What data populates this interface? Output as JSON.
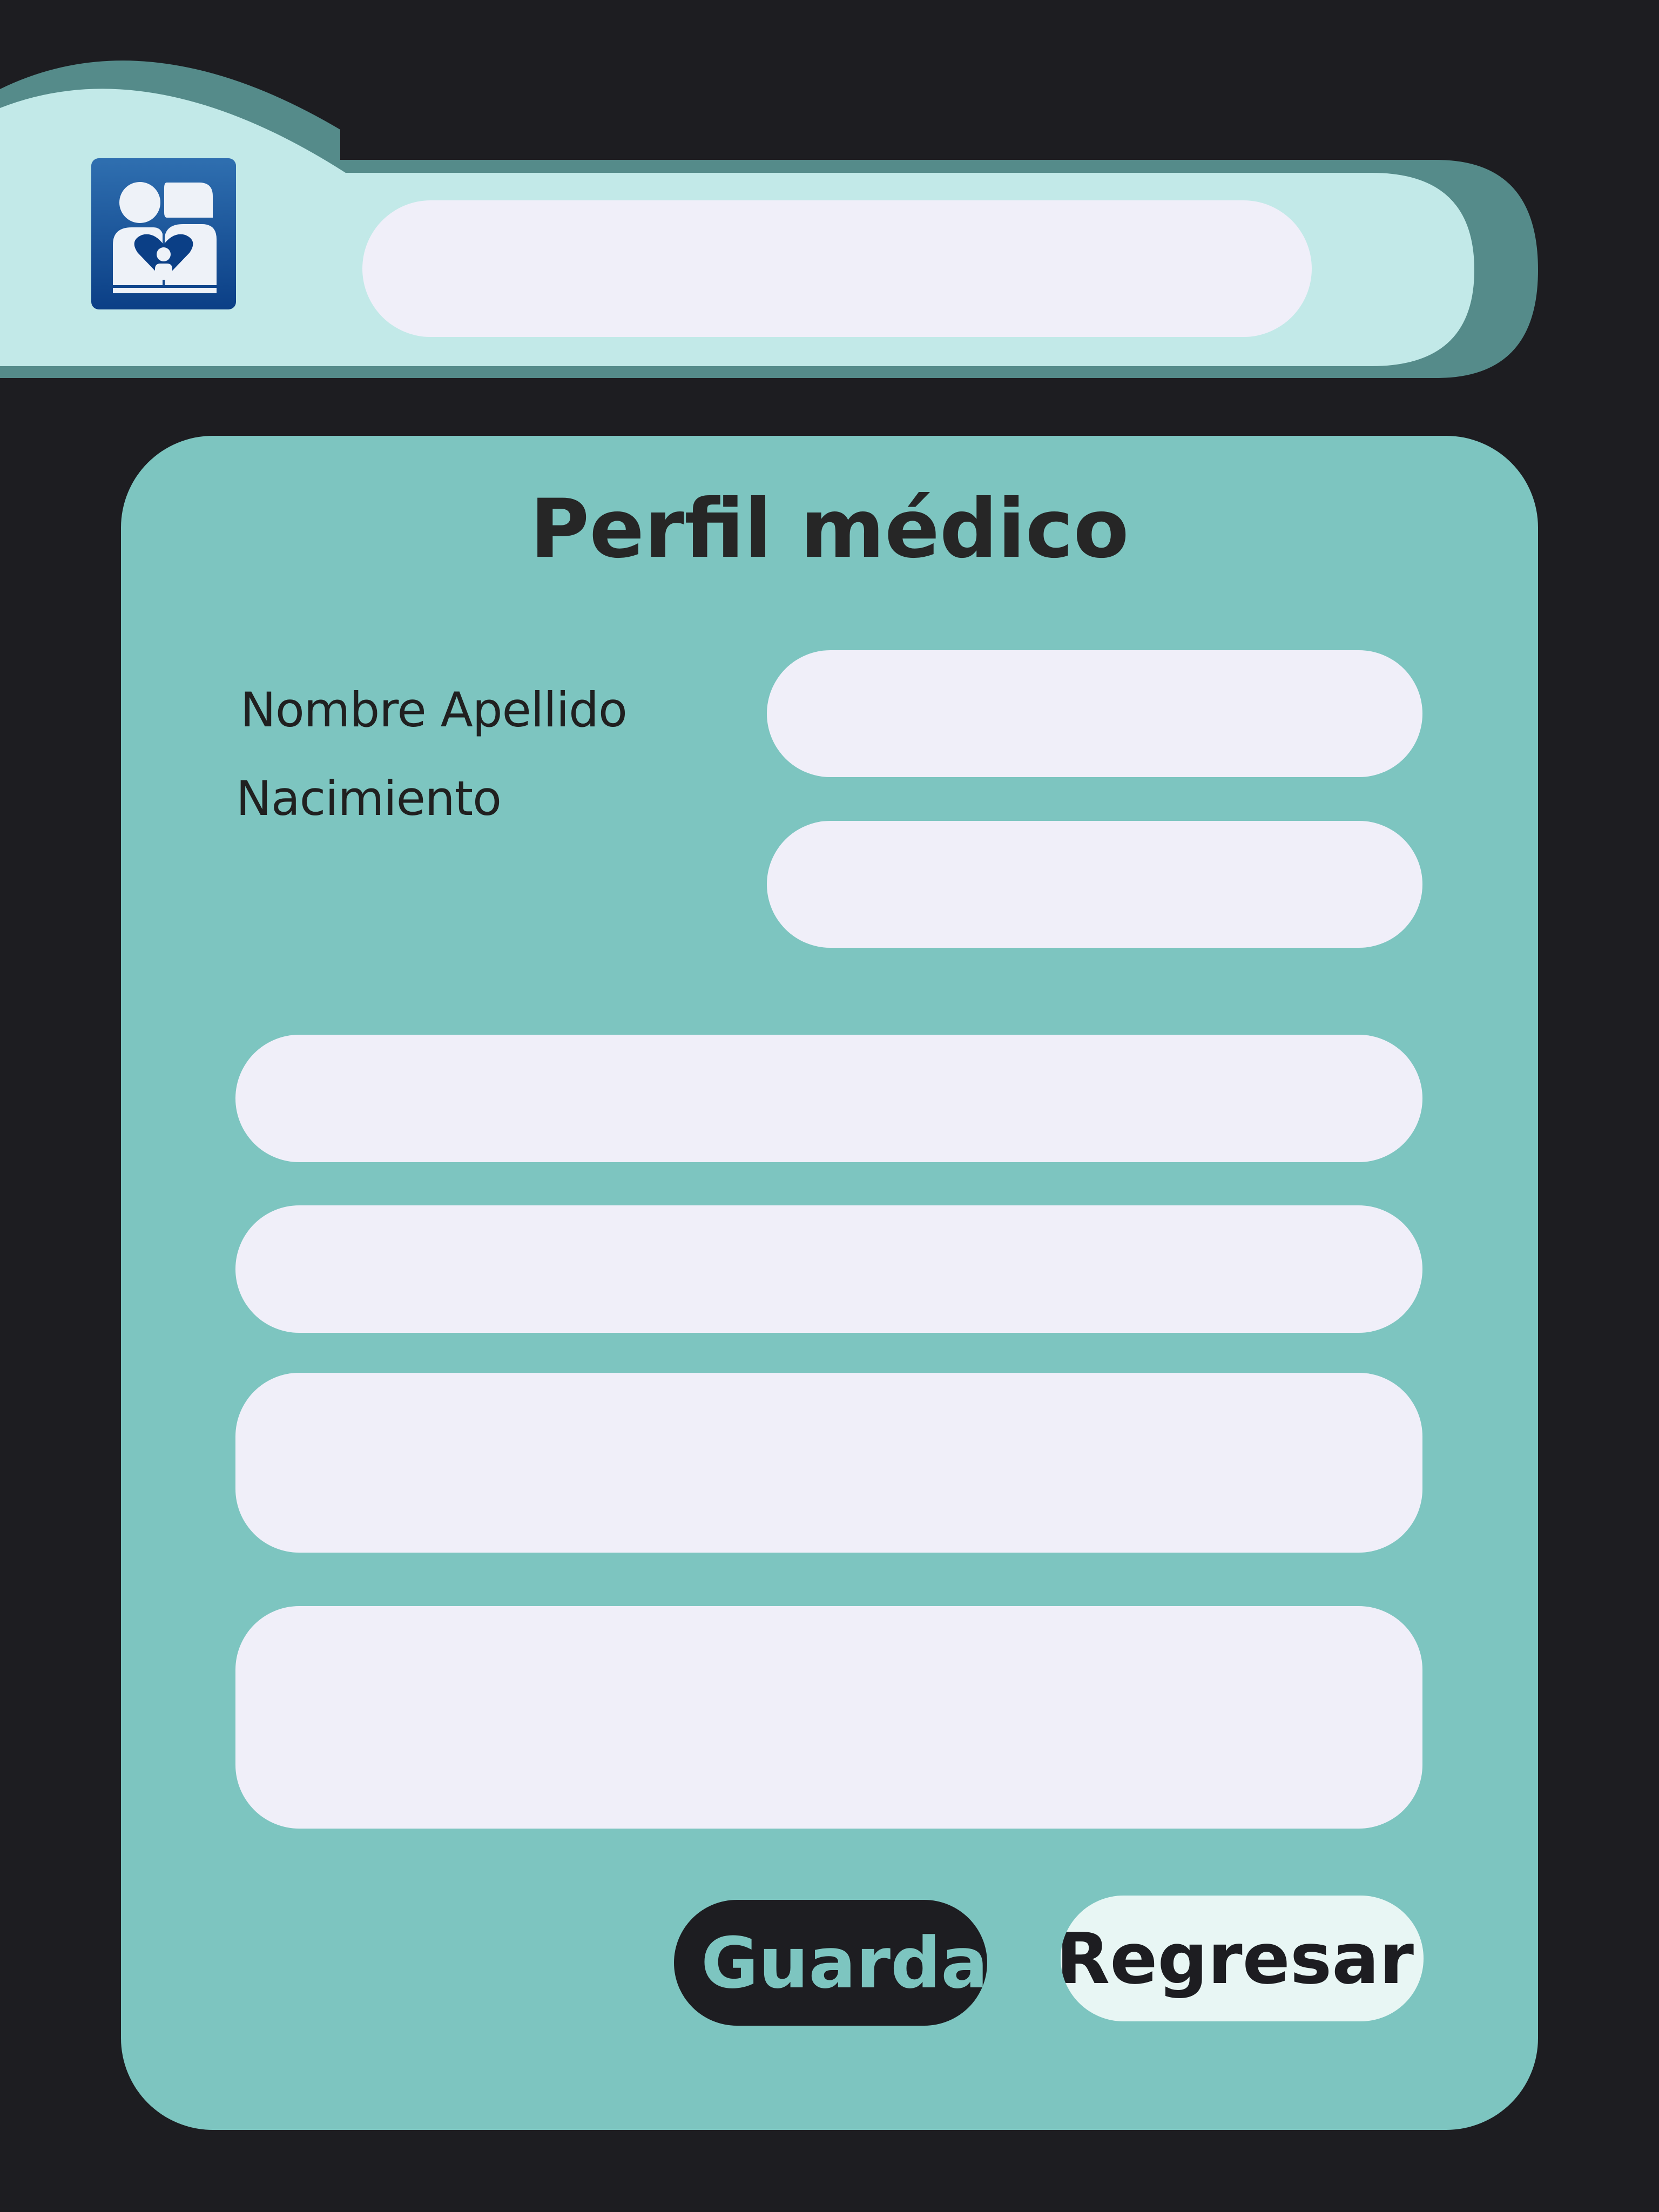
{
  "header": {
    "logo_icon": "family-care-icon",
    "search": {
      "value": "",
      "placeholder": ""
    },
    "colors": {
      "bar_light": "#c2e9e8",
      "bar_shadow": "#558b8a"
    }
  },
  "form": {
    "title": "Perfil médico",
    "labels": {
      "full_name": "Nombre Apellido",
      "birth": "Nacimiento"
    },
    "fields": {
      "full_name": "",
      "birth": "",
      "field_3": "",
      "field_4": "",
      "notes_1": "",
      "notes_2": ""
    },
    "buttons": {
      "save": "Guardar",
      "back": "Regresar"
    },
    "colors": {
      "card": "#7dc5c0",
      "field": "#f0eff9",
      "background": "#1d1d21"
    }
  }
}
